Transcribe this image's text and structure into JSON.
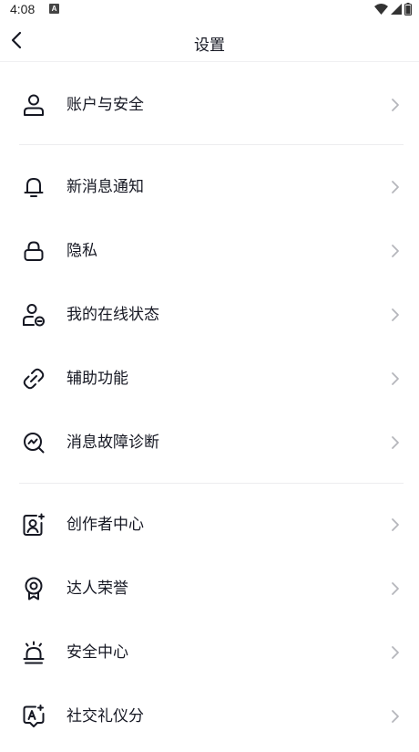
{
  "status_bar": {
    "time": "4:08",
    "notif_letter": "A"
  },
  "nav": {
    "title": "设置",
    "back_icon": "chevron-left-icon"
  },
  "groups": [
    {
      "items": [
        {
          "label": "账户与安全",
          "icon": "person-icon"
        }
      ]
    },
    {
      "items": [
        {
          "label": "新消息通知",
          "icon": "bell-icon"
        },
        {
          "label": "隐私",
          "icon": "lock-icon"
        },
        {
          "label": "我的在线状态",
          "icon": "person-status-icon"
        },
        {
          "label": "辅助功能",
          "icon": "link-icon"
        },
        {
          "label": "消息故障诊断",
          "icon": "diagnose-icon"
        }
      ]
    },
    {
      "items": [
        {
          "label": "创作者中心",
          "icon": "creator-icon"
        },
        {
          "label": "达人荣誉",
          "icon": "badge-icon"
        },
        {
          "label": "安全中心",
          "icon": "alarm-icon"
        },
        {
          "label": "社交礼仪分",
          "icon": "social-score-icon"
        }
      ]
    }
  ]
}
